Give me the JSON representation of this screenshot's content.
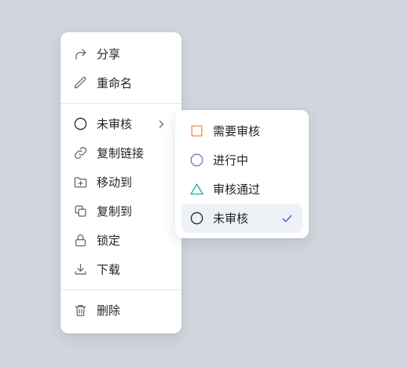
{
  "main_menu": {
    "items": [
      {
        "label": "分享",
        "icon": "share-icon"
      },
      {
        "label": "重命名",
        "icon": "pencil-icon"
      },
      {
        "label": "未审核",
        "icon": "circle-status-icon",
        "has_submenu": true
      },
      {
        "label": "复制链接",
        "icon": "link-icon"
      },
      {
        "label": "移动到",
        "icon": "folder-move-icon"
      },
      {
        "label": "复制到",
        "icon": "copy-icon"
      },
      {
        "label": "锁定",
        "icon": "lock-icon"
      },
      {
        "label": "下载",
        "icon": "download-icon"
      },
      {
        "label": "删除",
        "icon": "trash-icon"
      }
    ]
  },
  "status_submenu": {
    "items": [
      {
        "label": "需要审核",
        "icon": "square-icon",
        "color": "#e8965a"
      },
      {
        "label": "进行中",
        "icon": "octagon-icon",
        "color": "#6f86c4"
      },
      {
        "label": "审核通过",
        "icon": "triangle-icon",
        "color": "#26b5a6"
      },
      {
        "label": "未审核",
        "icon": "circle-icon",
        "color": "#30343a",
        "selected": true
      }
    ],
    "check_color": "#3b6fd6"
  },
  "colors": {
    "background": "#d1d6de",
    "menu_bg": "#ffffff",
    "icon_gray": "#5f6670",
    "text": "#1f2329",
    "selected_bg": "#eef1f6"
  }
}
